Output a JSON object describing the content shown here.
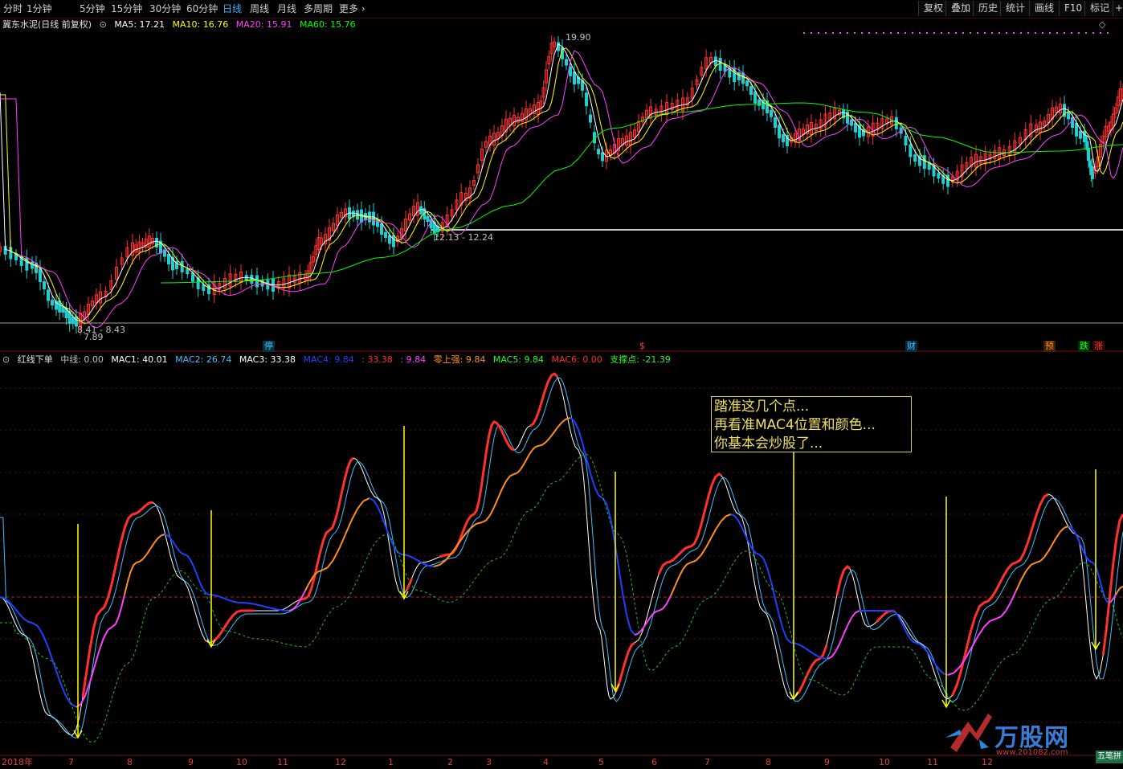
{
  "toolbar": {
    "periods": [
      "分时",
      "1分钟",
      "5分钟",
      "15分钟",
      "30分钟",
      "60分钟",
      "日线",
      "周线",
      "月线",
      "多周期",
      "更多"
    ],
    "active_period": "日线",
    "right_buttons": [
      "复权",
      "叠加",
      "历史",
      "统计",
      "画线",
      "F10",
      "标记"
    ]
  },
  "main_chart": {
    "stock_name": "冀东水泥(日线 前复权)",
    "ma": [
      {
        "label": "MA5: 17.21",
        "color": "#ffffff"
      },
      {
        "label": "MA10: 16.76",
        "color": "#ffff00"
      },
      {
        "label": "MA20: 15.91",
        "color": "#ff40ff"
      },
      {
        "label": "MA60: 15.76",
        "color": "#00ff00"
      }
    ],
    "annotations": {
      "high": "19.90",
      "mid_range": "12.13 - 12.24",
      "low_range": "8.41 - 8.43",
      "low": "7.89"
    },
    "markers": [
      {
        "text": "停",
        "color": "#40c0ff"
      },
      {
        "text": "$",
        "color": "#ff4040"
      },
      {
        "text": "财",
        "color": "#40c0ff"
      },
      {
        "text": "预",
        "color": "#ff9020"
      },
      {
        "text": "跌",
        "color": "#20ff20"
      },
      {
        "text": "涨",
        "color": "#ff4040"
      }
    ]
  },
  "indicator": {
    "name": "红线下单",
    "values": [
      {
        "label": "中线: 0.00",
        "color": "#c0c0c0"
      },
      {
        "label": "MAC1: 40.01",
        "color": "#ffffff"
      },
      {
        "label": "MAC2: 26.74",
        "color": "#40c0ff"
      },
      {
        "label": "MAC3: 33.38",
        "color": "#ffffff"
      },
      {
        "label": "MAC4: 9.84",
        "color": "#2040ff"
      },
      {
        "label": ": 33.38",
        "color": "#ff3030"
      },
      {
        "label": ": 9.84",
        "color": "#ff40ff"
      },
      {
        "label": "零上强: 9.84",
        "color": "#ff9020"
      },
      {
        "label": "MAC5: 9.84",
        "color": "#20ff20"
      },
      {
        "label": "MAC6: 0.00",
        "color": "#ff3030"
      },
      {
        "label": "支撑点: -21.39",
        "color": "#20ff20"
      }
    ],
    "note_lines": [
      "踏准这几个点...",
      "再看准MAC4位置和颜色...",
      "你基本会炒股了..."
    ]
  },
  "x_axis": {
    "labels": [
      "2018年",
      "7",
      "8",
      "9",
      "10",
      "11",
      "12",
      "1",
      "2",
      "3",
      "4",
      "5",
      "6",
      "7",
      "8",
      "9",
      "10",
      "11",
      "12"
    ]
  },
  "watermark": {
    "text": "万股网",
    "url": "www.201082.com",
    "corner": "五笔拼"
  },
  "colors": {
    "up": "#ff3030",
    "down": "#20d0d0",
    "ma5": "#ffffff",
    "ma10": "#ffff00",
    "ma20": "#ff40ff",
    "ma60": "#00ff00",
    "arrow": "#ffff00"
  }
}
